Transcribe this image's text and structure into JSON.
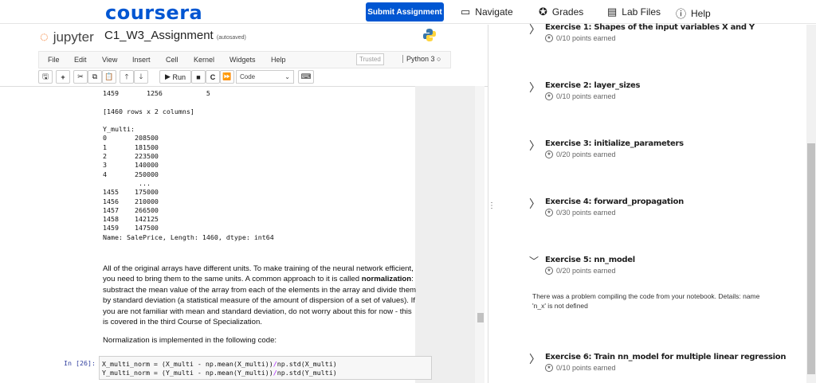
{
  "header": {
    "logo": "coursera",
    "submit": "Submit Assignment",
    "nav": [
      {
        "label": "Navigate",
        "icon": "window-icon"
      },
      {
        "label": "Grades",
        "icon": "star-badge-icon"
      },
      {
        "label": "Lab Files",
        "icon": "file-icon"
      },
      {
        "label": "Help",
        "icon": "help-icon"
      }
    ]
  },
  "notebook": {
    "brand": "jupyter",
    "title": "C1_W3_Assignment",
    "autosave": "(autosaved)",
    "menu": [
      "File",
      "Edit",
      "View",
      "Insert",
      "Cell",
      "Kernel",
      "Widgets",
      "Help"
    ],
    "trusted": "Trusted",
    "kernel": "Python 3",
    "run": "Run",
    "cell_type": "Code",
    "output": "1459       1256           5\n\n[1460 rows x 2 columns]\n\nY_multi:\n0       208500\n1       181500\n2       223500\n3       140000\n4       250000\n         ...\n1455    175000\n1456    210000\n1457    266500\n1458    142125\n1459    147500\nName: SalePrice, Length: 1460, dtype: int64",
    "md_before": "All of the original arrays have different units. To make training of the neural network efficient, you need to bring them to the same units. A common approach to it is called ",
    "md_bold": "normalization",
    "md_after": ": substract the mean value of the array from each of the elements in the array and divide them by standard deviation (a statistical measure of the amount of dispersion of a set of values). If you are not familiar with mean and standard deviation, do not worry about this for now - this is covered in the third Course of Specialization.",
    "md2": "Normalization is implemented in the following code:",
    "prompt": "In [26]:",
    "code1a": "X_multi_norm = (X_multi - np.mean(X_multi))",
    "code1b": "/",
    "code1c": "np.std(X_multi)",
    "code2a": "Y_multi_norm = (Y_multi - np.mean(Y_multi))",
    "code2b": "/",
    "code2c": "np.std(Y_multi)"
  },
  "grader": {
    "exercises": [
      {
        "title": "Exercise 1: Shapes of the input variables X and Y",
        "points": "0/10 points earned",
        "expanded": false
      },
      {
        "title": "Exercise 2: layer_sizes",
        "points": "0/10 points earned",
        "expanded": false
      },
      {
        "title": "Exercise 3: initialize_parameters",
        "points": "0/20 points earned",
        "expanded": false
      },
      {
        "title": "Exercise 4: forward_propagation",
        "points": "0/30 points earned",
        "expanded": false
      },
      {
        "title": "Exercise 5: nn_model",
        "points": "0/20 points earned",
        "expanded": true
      },
      {
        "title": "Exercise 6: Train nn_model for multiple linear regression",
        "points": "0/10 points earned",
        "expanded": false
      }
    ],
    "error": "There was a problem compiling the code from your notebook. Details: name 'n_x' is not defined"
  },
  "colors": {
    "brand": "#0056d2",
    "jupyter": "#f37626"
  }
}
